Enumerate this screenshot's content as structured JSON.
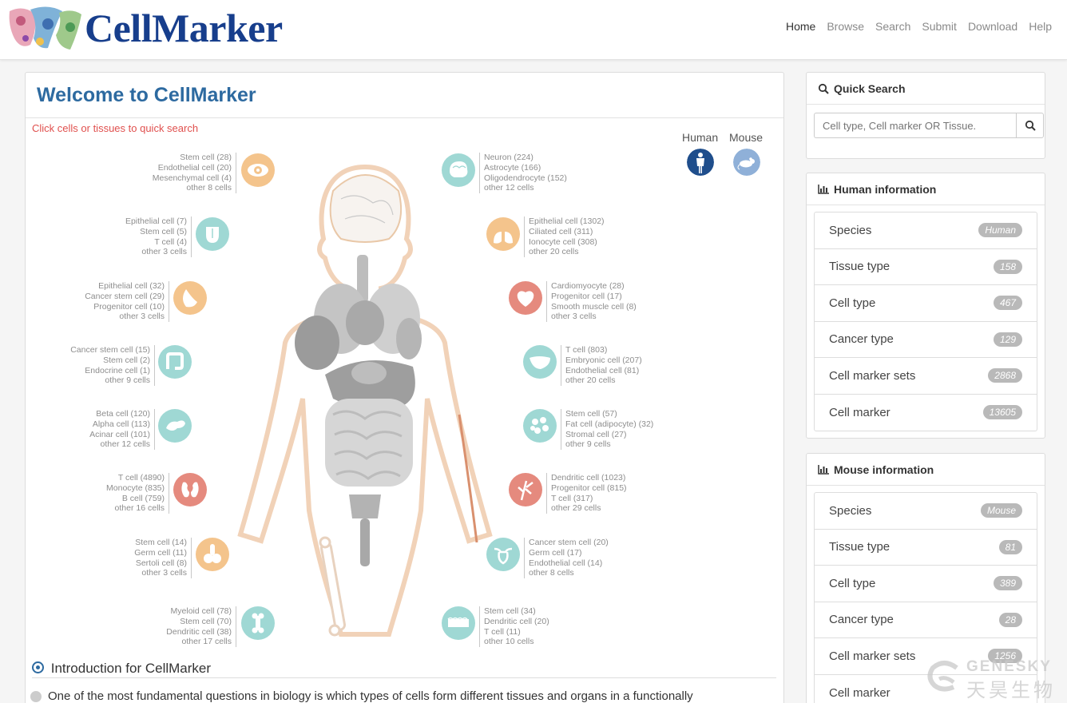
{
  "header": {
    "logo_text": "CellMarker",
    "nav": [
      "Home",
      "Browse",
      "Search",
      "Submit",
      "Download",
      "Help"
    ],
    "active_nav": "Home"
  },
  "main": {
    "title": "Welcome to CellMarker",
    "hint": "Click cells or tissues to quick search",
    "species": [
      "Human",
      "Mouse"
    ],
    "left_organs": [
      {
        "icon": "eye-icon",
        "color": "orange",
        "lines": [
          "Stem cell (28)",
          "Endothelial cell (20)",
          "Mesenchymal cell (4)",
          "other 8 cells"
        ]
      },
      {
        "icon": "tongue-icon",
        "color": "teal",
        "lines": [
          "Epithelial cell (7)",
          "Stem cell (5)",
          "T cell (4)",
          "other 3 cells"
        ]
      },
      {
        "icon": "breast-icon",
        "color": "orange",
        "lines": [
          "Epithelial cell (32)",
          "Cancer stem cell (29)",
          "Progenitor cell (10)",
          "other 3 cells"
        ]
      },
      {
        "icon": "intestine-icon",
        "color": "teal",
        "lines": [
          "Cancer stem cell (15)",
          "Stem cell (2)",
          "Endocrine cell (1)",
          "other 9 cells"
        ]
      },
      {
        "icon": "pancreas-icon",
        "color": "teal",
        "lines": [
          "Beta cell (120)",
          "Alpha cell (113)",
          "Acinar cell (101)",
          "other 12 cells"
        ]
      },
      {
        "icon": "kidney-icon",
        "color": "red",
        "lines": [
          "T cell (4890)",
          "Monocyte (835)",
          "B cell (759)",
          "other 16 cells"
        ]
      },
      {
        "icon": "testis-icon",
        "color": "orange",
        "lines": [
          "Stem cell (14)",
          "Germ cell (11)",
          "Sertoli cell (8)",
          "other 3 cells"
        ]
      },
      {
        "icon": "bone-icon",
        "color": "teal",
        "lines": [
          "Myeloid cell (78)",
          "Stem cell (70)",
          "Dendritic cell (38)",
          "other 17 cells"
        ]
      }
    ],
    "right_organs": [
      {
        "icon": "brain-icon",
        "color": "teal",
        "lines": [
          "Neuron (224)",
          "Astrocyte (166)",
          "Oligodendrocyte (152)",
          "other 12 cells"
        ]
      },
      {
        "icon": "lung-icon",
        "color": "orange",
        "lines": [
          "Epithelial cell (1302)",
          "Ciliated cell (311)",
          "Ionocyte cell (308)",
          "other 20 cells"
        ]
      },
      {
        "icon": "heart-icon",
        "color": "red",
        "lines": [
          "Cardiomyocyte (28)",
          "Progenitor cell (17)",
          "Smooth muscle cell (8)",
          "other 3 cells"
        ]
      },
      {
        "icon": "liver-icon",
        "color": "teal",
        "lines": [
          "T cell (803)",
          "Embryonic cell (207)",
          "Endothelial cell (81)",
          "other 20 cells"
        ]
      },
      {
        "icon": "adipose-icon",
        "color": "teal",
        "lines": [
          "Stem cell (57)",
          "Fat cell (adipocyte) (32)",
          "Stromal cell (27)",
          "other 9 cells"
        ]
      },
      {
        "icon": "vessel-icon",
        "color": "red",
        "lines": [
          "Dendritic cell (1023)",
          "Progenitor cell (815)",
          "T cell (317)",
          "other 29 cells"
        ]
      },
      {
        "icon": "uterus-icon",
        "color": "teal",
        "lines": [
          "Cancer stem cell (20)",
          "Germ cell (17)",
          "Endothelial cell (14)",
          "other 8 cells"
        ]
      },
      {
        "icon": "skin-icon",
        "color": "teal",
        "lines": [
          "Stem cell (34)",
          "Dendritic cell (20)",
          "T cell (11)",
          "other 10 cells"
        ]
      }
    ],
    "intro_title": "Introduction for CellMarker",
    "intro_text": "One of the most fundamental questions in biology is which types of cells form different tissues and organs in a functionally"
  },
  "sidebar": {
    "quick_search": {
      "title": "Quick Search",
      "placeholder": "Cell type, Cell marker OR Tissue."
    },
    "human": {
      "title": "Human information",
      "items": [
        {
          "label": "Species",
          "badge": "Human"
        },
        {
          "label": "Tissue type",
          "badge": "158"
        },
        {
          "label": "Cell type",
          "badge": "467"
        },
        {
          "label": "Cancer type",
          "badge": "129"
        },
        {
          "label": "Cell marker sets",
          "badge": "2868"
        },
        {
          "label": "Cell marker",
          "badge": "13605"
        }
      ]
    },
    "mouse": {
      "title": "Mouse information",
      "items": [
        {
          "label": "Species",
          "badge": "Mouse"
        },
        {
          "label": "Tissue type",
          "badge": "81"
        },
        {
          "label": "Cell type",
          "badge": "389"
        },
        {
          "label": "Cancer type",
          "badge": "28"
        },
        {
          "label": "Cell marker sets",
          "badge": "1256"
        },
        {
          "label": "Cell marker",
          "badge": ""
        }
      ]
    }
  },
  "watermark": {
    "line1": "GENESKY",
    "line2": "天昊生物"
  }
}
